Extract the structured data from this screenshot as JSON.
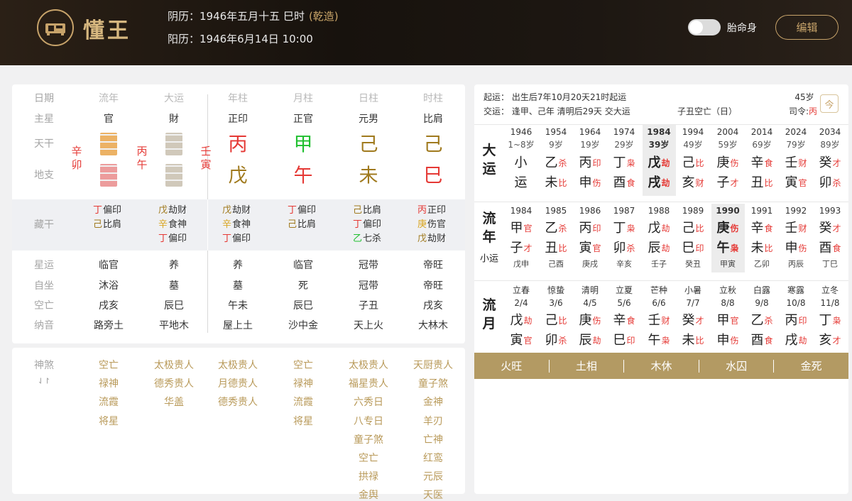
{
  "header": {
    "brand": "懂王",
    "lunar": "阴历：1946年五月十五 巳时",
    "gender": "(乾造)",
    "solar": "阳历：1946年6月14日 10:00",
    "toggle_label": "胎命身",
    "edit": "编辑"
  },
  "left": {
    "labels": {
      "date": "日期",
      "master": "主星",
      "tiangan": "天干",
      "dizhi": "地支",
      "canggan": "藏干",
      "xingyun": "星运",
      "zizuo": "自坐",
      "kongwang": "空亡",
      "nayin": "纳音",
      "shensha": "神煞",
      "shensha_toggle": "⇃↾"
    },
    "headers": [
      "流年",
      "大运",
      "年柱",
      "月柱",
      "日柱",
      "时柱"
    ],
    "masters": [
      "官",
      "財",
      "正印",
      "正官",
      "元男",
      "比肩"
    ],
    "side": {
      "liunian": "辛卯",
      "dayun": "丙午",
      "nian": "壬寅"
    },
    "tiangan": [
      {
        "c": "丙",
        "color": "#e53935"
      },
      {
        "c": "甲",
        "color": "#1fbf2e"
      },
      {
        "c": "己",
        "color": "#a07a1e"
      },
      {
        "c": "己",
        "color": "#a07a1e"
      }
    ],
    "dizhi": [
      {
        "c": "戊",
        "color": "#a07a1e"
      },
      {
        "c": "午",
        "color": "#e53935"
      },
      {
        "c": "未",
        "color": "#a07a1e"
      },
      {
        "c": "巳",
        "color": "#e53935"
      }
    ],
    "canggan": [
      [
        {
          "s": "丁",
          "n": "偏印",
          "c": "#e53935"
        },
        {
          "s": "己",
          "n": "比肩",
          "c": "#a07a1e"
        }
      ],
      [
        {
          "s": "戊",
          "n": "劫财",
          "c": "#a07a1e"
        },
        {
          "s": "辛",
          "n": "食神",
          "c": "#d9a520"
        },
        {
          "s": "丁",
          "n": "偏印",
          "c": "#e53935"
        }
      ],
      [
        {
          "s": "戊",
          "n": "劫财",
          "c": "#a07a1e"
        },
        {
          "s": "辛",
          "n": "食神",
          "c": "#d9a520"
        },
        {
          "s": "丁",
          "n": "偏印",
          "c": "#e53935"
        }
      ],
      [
        {
          "s": "丁",
          "n": "偏印",
          "c": "#e53935"
        },
        {
          "s": "己",
          "n": "比肩",
          "c": "#a07a1e"
        }
      ],
      [
        {
          "s": "己",
          "n": "比肩",
          "c": "#a07a1e"
        },
        {
          "s": "丁",
          "n": "偏印",
          "c": "#e53935"
        },
        {
          "s": "乙",
          "n": "七杀",
          "c": "#1fbf2e"
        }
      ],
      [
        {
          "s": "丙",
          "n": "正印",
          "c": "#e53935"
        },
        {
          "s": "庚",
          "n": "伤官",
          "c": "#d9a520"
        },
        {
          "s": "戊",
          "n": "劫财",
          "c": "#a07a1e"
        }
      ]
    ],
    "xingyun": [
      "临官",
      "养",
      "养",
      "临官",
      "冠带",
      "帝旺"
    ],
    "zizuo": [
      "沐浴",
      "墓",
      "墓",
      "死",
      "冠带",
      "帝旺"
    ],
    "kongwang": [
      "戌亥",
      "辰巳",
      "午未",
      "辰巳",
      "子丑",
      "戌亥"
    ],
    "nayin": [
      "路旁土",
      "平地木",
      "屋上土",
      "沙中金",
      "天上火",
      "大林木"
    ],
    "shensha": [
      [
        "空亡",
        "禄神",
        "流霞",
        "将星"
      ],
      [
        "太极贵人",
        "德秀贵人",
        "华盖"
      ],
      [
        "太极贵人",
        "月德贵人",
        "德秀贵人"
      ],
      [
        "空亡",
        "禄神",
        "流霞",
        "将星"
      ],
      [
        "太极贵人",
        "福星贵人",
        "六秀日",
        "八专日",
        "童子煞",
        "空亡",
        "拱禄",
        "金舆"
      ],
      [
        "天厨贵人",
        "童子煞",
        "金神",
        "羊刃",
        "亡神",
        "红鸾",
        "元辰",
        "天医"
      ]
    ]
  },
  "right": {
    "qiyun": "起运：  出生后7年10月20天21时起运",
    "jiaoyun": "交运：  逢甲、己年 清明后29天 交大运",
    "kongwang": "子丑空亡（日）",
    "age": "45岁",
    "siling_label": "司令:",
    "siling": "丙",
    "today_icon": "今",
    "dayun_title": "大运",
    "liunian_title": "流年",
    "xiaoyun_title": "小运",
    "liuyue_title": "流月",
    "dayun": [
      {
        "y": "1946",
        "a": "1~8岁",
        "t": "小",
        "ts": "",
        "b": "运",
        "bs": ""
      },
      {
        "y": "1954",
        "a": "9岁",
        "t": "乙",
        "ts": "杀",
        "b": "未",
        "bs": "比"
      },
      {
        "y": "1964",
        "a": "19岁",
        "t": "丙",
        "ts": "印",
        "b": "申",
        "bs": "伤"
      },
      {
        "y": "1974",
        "a": "29岁",
        "t": "丁",
        "ts": "枭",
        "b": "酉",
        "bs": "食"
      },
      {
        "y": "1984",
        "a": "39岁",
        "t": "戊",
        "ts": "劫",
        "b": "戌",
        "bs": "劫"
      },
      {
        "y": "1994",
        "a": "49岁",
        "t": "己",
        "ts": "比",
        "b": "亥",
        "bs": "财"
      },
      {
        "y": "2004",
        "a": "59岁",
        "t": "庚",
        "ts": "伤",
        "b": "子",
        "bs": "才"
      },
      {
        "y": "2014",
        "a": "69岁",
        "t": "辛",
        "ts": "食",
        "b": "丑",
        "bs": "比"
      },
      {
        "y": "2024",
        "a": "79岁",
        "t": "壬",
        "ts": "财",
        "b": "寅",
        "bs": "官"
      },
      {
        "y": "2034",
        "a": "89岁",
        "t": "癸",
        "ts": "才",
        "b": "卯",
        "bs": "杀"
      }
    ],
    "liunian": [
      {
        "y": "1984",
        "t": "甲",
        "ts": "官",
        "b": "子",
        "bs": "才",
        "x": "戊申"
      },
      {
        "y": "1985",
        "t": "乙",
        "ts": "杀",
        "b": "丑",
        "bs": "比",
        "x": "己酉"
      },
      {
        "y": "1986",
        "t": "丙",
        "ts": "印",
        "b": "寅",
        "bs": "官",
        "x": "庚戌"
      },
      {
        "y": "1987",
        "t": "丁",
        "ts": "枭",
        "b": "卯",
        "bs": "杀",
        "x": "辛亥"
      },
      {
        "y": "1988",
        "t": "戊",
        "ts": "劫",
        "b": "辰",
        "bs": "劫",
        "x": "壬子"
      },
      {
        "y": "1989",
        "t": "己",
        "ts": "比",
        "b": "巳",
        "bs": "印",
        "x": "癸丑"
      },
      {
        "y": "1990",
        "t": "庚",
        "ts": "伤",
        "b": "午",
        "bs": "枭",
        "x": "甲寅"
      },
      {
        "y": "1991",
        "t": "辛",
        "ts": "食",
        "b": "未",
        "bs": "比",
        "x": "乙卯"
      },
      {
        "y": "1992",
        "t": "壬",
        "ts": "财",
        "b": "申",
        "bs": "伤",
        "x": "丙辰"
      },
      {
        "y": "1993",
        "t": "癸",
        "ts": "才",
        "b": "酉",
        "bs": "食",
        "x": "丁巳"
      }
    ],
    "liuyue": [
      {
        "n": "立春",
        "d": "2/4",
        "t": "戊",
        "ts": "劫",
        "b": "寅",
        "bs": "官"
      },
      {
        "n": "惊蛰",
        "d": "3/6",
        "t": "己",
        "ts": "比",
        "b": "卯",
        "bs": "杀"
      },
      {
        "n": "清明",
        "d": "4/5",
        "t": "庚",
        "ts": "伤",
        "b": "辰",
        "bs": "劫"
      },
      {
        "n": "立夏",
        "d": "5/6",
        "t": "辛",
        "ts": "食",
        "b": "巳",
        "bs": "印"
      },
      {
        "n": "芒种",
        "d": "6/6",
        "t": "壬",
        "ts": "财",
        "b": "午",
        "bs": "枭"
      },
      {
        "n": "小暑",
        "d": "7/7",
        "t": "癸",
        "ts": "才",
        "b": "未",
        "bs": "比"
      },
      {
        "n": "立秋",
        "d": "8/8",
        "t": "甲",
        "ts": "官",
        "b": "申",
        "bs": "伤"
      },
      {
        "n": "白露",
        "d": "9/8",
        "t": "乙",
        "ts": "杀",
        "b": "酉",
        "bs": "食"
      },
      {
        "n": "寒露",
        "d": "10/8",
        "t": "丙",
        "ts": "印",
        "b": "戌",
        "bs": "劫"
      },
      {
        "n": "立冬",
        "d": "11/8",
        "t": "丁",
        "ts": "枭",
        "b": "亥",
        "bs": "才"
      }
    ],
    "wuxing": [
      "火旺",
      "土相",
      "木休",
      "水囚",
      "金死"
    ]
  }
}
